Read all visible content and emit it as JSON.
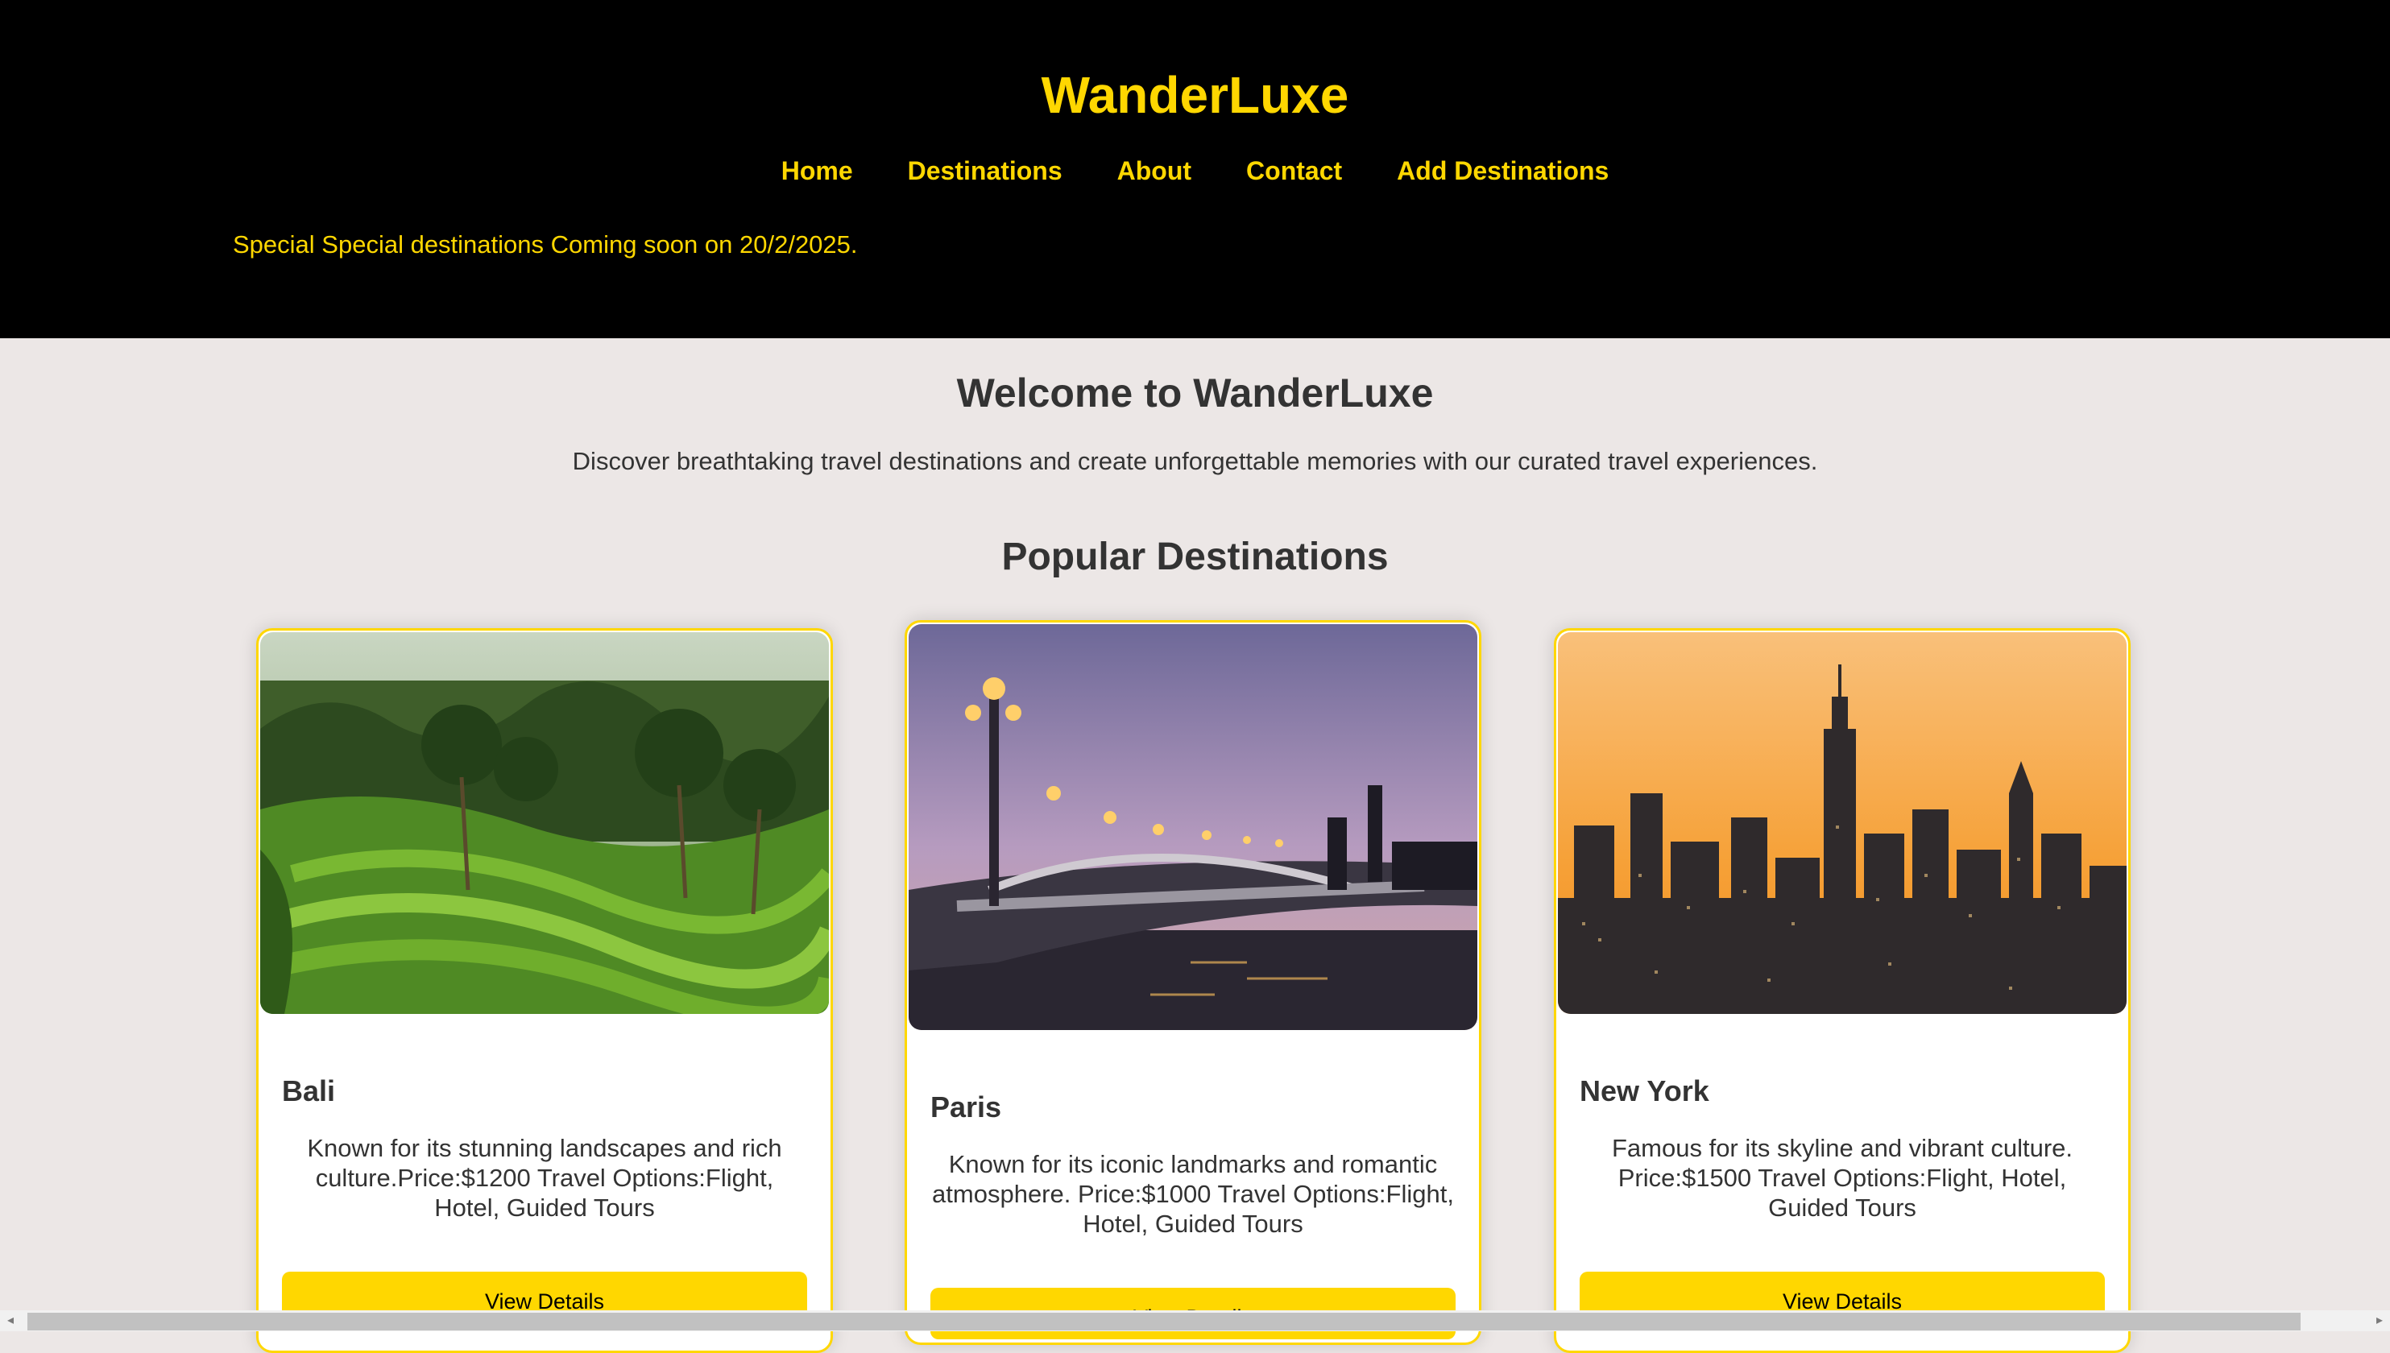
{
  "header": {
    "brand": "WanderLuxe",
    "nav": [
      "Home",
      "Destinations",
      "About",
      "Contact",
      "Add Destinations"
    ],
    "announcement": "Special Special destinations Coming soon on 20/2/2025."
  },
  "hero": {
    "title": "Welcome to WanderLuxe",
    "subtitle": "Discover breathtaking travel destinations and create unforgettable memories with our curated travel experiences."
  },
  "destinations": {
    "title": "Popular Destinations",
    "cards": [
      {
        "name": "Bali",
        "description": "Known for its stunning landscapes and rich culture.Price:$1200 Travel Options:Flight, Hotel, Guided Tours",
        "button": "View Details",
        "image": "rice-terraces"
      },
      {
        "name": "Paris",
        "description": "Known for its iconic landmarks and romantic atmosphere. Price:$1000 Travel Options:Flight, Hotel, Guided Tours",
        "button": "View Details",
        "image": "bridge-at-dusk"
      },
      {
        "name": "New York",
        "description": "Famous for its skyline and vibrant culture. Price:$1500 Travel Options:Flight, Hotel, Guided Tours",
        "button": "View Details",
        "image": "city-skyline"
      }
    ]
  },
  "theme": {
    "accent": "#ffd700",
    "header_bg": "#000000",
    "page_bg": "#ece7e6",
    "text": "#333333"
  }
}
